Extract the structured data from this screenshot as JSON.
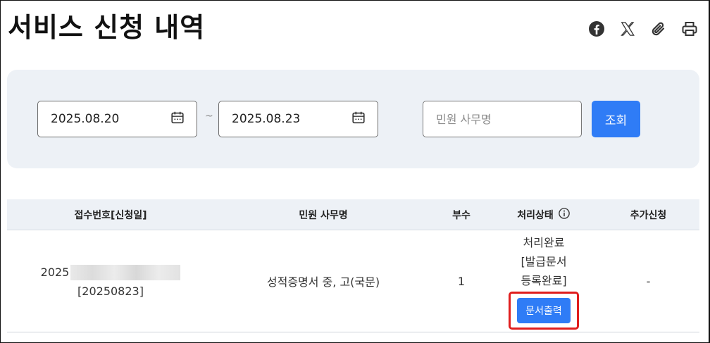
{
  "page": {
    "title": "서비스 신청 내역"
  },
  "share_icons": [
    "facebook-icon",
    "x-icon",
    "paperclip-icon",
    "print-icon"
  ],
  "search": {
    "start_date": "2025.08.20",
    "separator": "~",
    "end_date": "2025.08.23",
    "name_placeholder": "민원 사무명",
    "search_label": "조회"
  },
  "table": {
    "headers": [
      "접수번호[신청일]",
      "민원 사무명",
      "부수",
      "처리상태",
      "추가신청"
    ],
    "rows": [
      {
        "receipt_prefix": "2025",
        "apply_date": "[20250823]",
        "service_name": "성적증명서 중, 고(국문)",
        "copies": "1",
        "status_line1": "처리완료",
        "status_line2": "[발급문서",
        "status_line3": "등록완료]",
        "print_label": "문서출력",
        "extra": "-"
      }
    ]
  },
  "colors": {
    "accent": "#2f7cf6",
    "highlight": "#e01e1e",
    "panel": "#edf1f6"
  }
}
